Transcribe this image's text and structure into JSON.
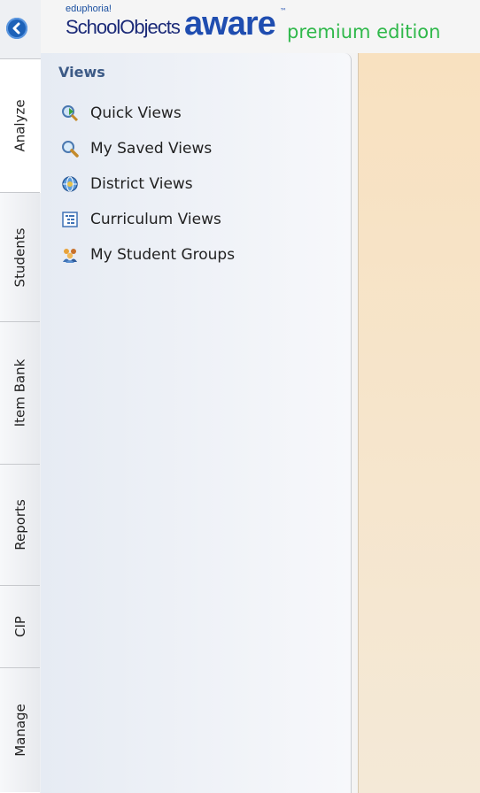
{
  "logo": {
    "edu": "eduphoria!",
    "school_objects": "SchoolObjects",
    "aware": "aware",
    "tm": "™",
    "edition": "premium edition"
  },
  "tabs": [
    {
      "label": "Analyze",
      "active": true
    },
    {
      "label": "Students",
      "active": false
    },
    {
      "label": "Item Bank",
      "active": false
    },
    {
      "label": "Reports",
      "active": false
    },
    {
      "label": "CIP",
      "active": false
    },
    {
      "label": "Manage",
      "active": false
    }
  ],
  "panel": {
    "title": "Views",
    "items": [
      {
        "label": "Quick Views",
        "icon": "quick-views-icon"
      },
      {
        "label": "My Saved Views",
        "icon": "magnifier-icon"
      },
      {
        "label": "District Views",
        "icon": "globe-icon"
      },
      {
        "label": "Curriculum Views",
        "icon": "outline-tree-icon"
      },
      {
        "label": "My Student Groups",
        "icon": "group-icon"
      }
    ]
  },
  "colors": {
    "tab_background": "#eef0f3",
    "panel_background": "#e6ebf3",
    "content_background": "#f8e1c0",
    "accent_blue": "#1f4db0",
    "edition_green": "#2fb84a"
  }
}
